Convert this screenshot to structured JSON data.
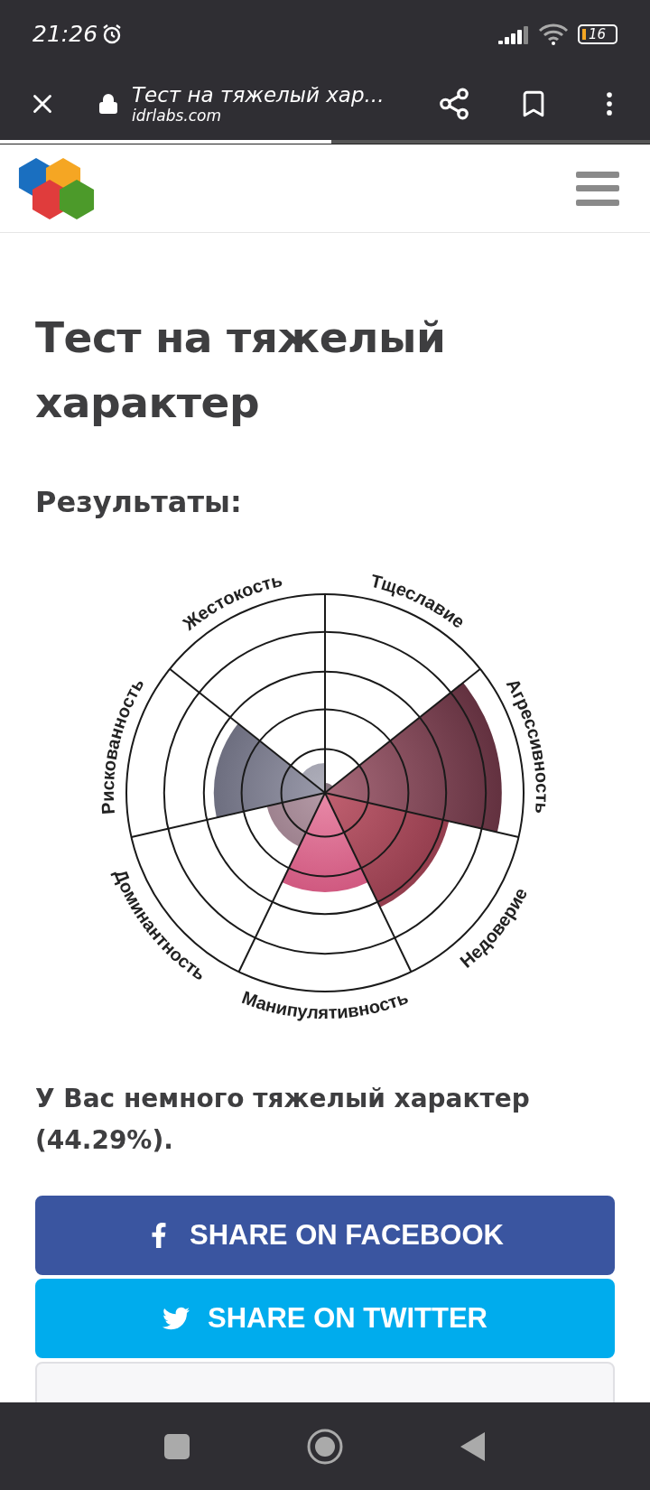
{
  "status_bar": {
    "time": "21:26",
    "battery": "16"
  },
  "browser_bar": {
    "title": "Тест на тяжелый хар...",
    "url": "idrlabs.com",
    "page_load": {
      "level": 0.51
    }
  },
  "page": {
    "title": "Тест на тяжелый характер",
    "subtitle": "Результаты:",
    "chart_labels": [
      "Тщеславие",
      "Агрессивность",
      "Недоверие",
      "Манипулятивность",
      "Доминантность",
      "Рискованность",
      "Жестокость"
    ],
    "result": "У Вас немного тяжелый характер (44.29%).",
    "buttons": [
      {
        "kind": "facebook",
        "label": "SHARE ON FACEBOOK"
      },
      {
        "kind": "twitter",
        "label": "SHARE ON TWITTER"
      },
      {
        "kind": "retake"
      }
    ]
  }
}
